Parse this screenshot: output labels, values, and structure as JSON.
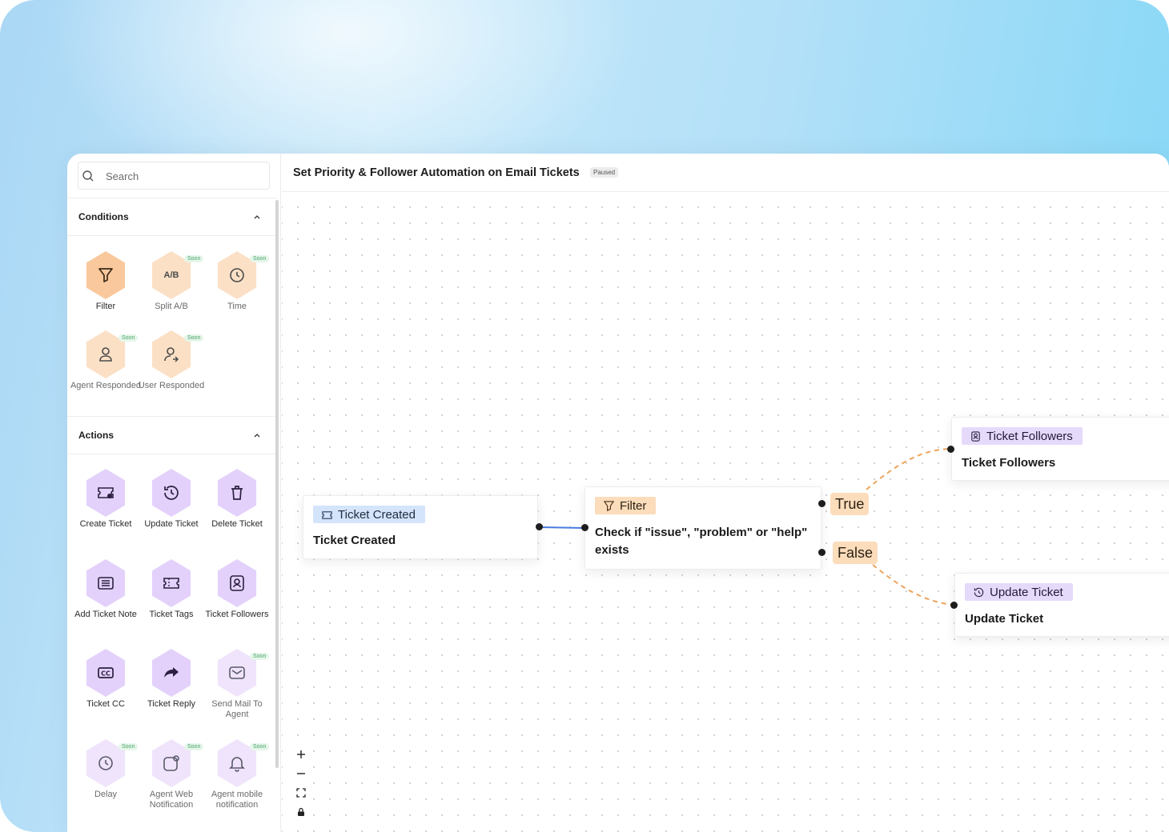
{
  "search": {
    "placeholder": "Search"
  },
  "sections": {
    "conditions": {
      "title": "Conditions",
      "collapse_icon": "chevron-up-icon"
    },
    "actions": {
      "title": "Actions",
      "collapse_icon": "chevron-up-icon"
    }
  },
  "conditions": [
    {
      "label": "Filter",
      "icon": "filter-icon",
      "soon": false
    },
    {
      "label": "Split A/B",
      "icon_text": "A/B",
      "soon": true,
      "badge": "Soon"
    },
    {
      "label": "Time",
      "icon": "clock-icon",
      "soon": true,
      "badge": "Soon"
    },
    {
      "label": "Agent Responded",
      "icon": "user-icon",
      "soon": true,
      "badge": "Soon"
    },
    {
      "label": "User Responded",
      "icon": "user-reply-icon",
      "soon": true,
      "badge": "Soon"
    }
  ],
  "actions": [
    {
      "label": "Create Ticket",
      "icon": "ticket-add-icon",
      "soon": false
    },
    {
      "label": "Update Ticket",
      "icon": "history-icon",
      "soon": false
    },
    {
      "label": "Delete Ticket",
      "icon": "trash-icon",
      "soon": false
    },
    {
      "label": "Add Ticket Note",
      "icon": "note-icon",
      "soon": false
    },
    {
      "label": "Ticket Tags",
      "icon": "ticket-icon",
      "soon": false
    },
    {
      "label": "Ticket Followers",
      "icon": "follower-icon",
      "soon": false
    },
    {
      "label": "Ticket CC",
      "icon": "cc-icon",
      "soon": false
    },
    {
      "label": "Ticket Reply",
      "icon": "reply-arrow-icon",
      "soon": false
    },
    {
      "label": "Send Mail To Agent",
      "icon": "mail-icon",
      "soon": true,
      "badge": "Soon"
    },
    {
      "label": "Delay",
      "icon": "clock-icon",
      "soon": true,
      "badge": "Soon"
    },
    {
      "label": "Agent Web Notification",
      "icon": "web-notification-icon",
      "soon": true,
      "badge": "Soon"
    },
    {
      "label": "Agent mobile notification",
      "icon": "bell-icon",
      "soon": true,
      "badge": "Soon"
    }
  ],
  "header": {
    "title": "Set Priority & Follower Automation on Email Tickets",
    "status": "Paused"
  },
  "nodes": {
    "trigger": {
      "chip": "Ticket Created",
      "body": "Ticket Created"
    },
    "filter": {
      "chip": "Filter",
      "body_line1": "Check if \"issue\", \"problem\" or \"help\"",
      "body_line2": "exists"
    },
    "followers": {
      "chip": "Ticket Followers",
      "body": "Ticket Followers"
    },
    "update": {
      "chip": "Update Ticket",
      "body": "Update Ticket"
    }
  },
  "branches": {
    "true_label": "True",
    "false_label": "False"
  },
  "colors": {
    "accent_orange": "#f9c89c",
    "accent_purple": "#e3d1fb",
    "edge_blue": "#4a7be0",
    "edge_orange": "#eda45a"
  },
  "zoom_controls": [
    "zoom-in-icon",
    "zoom-out-icon",
    "fit-view-icon",
    "lock-icon"
  ]
}
